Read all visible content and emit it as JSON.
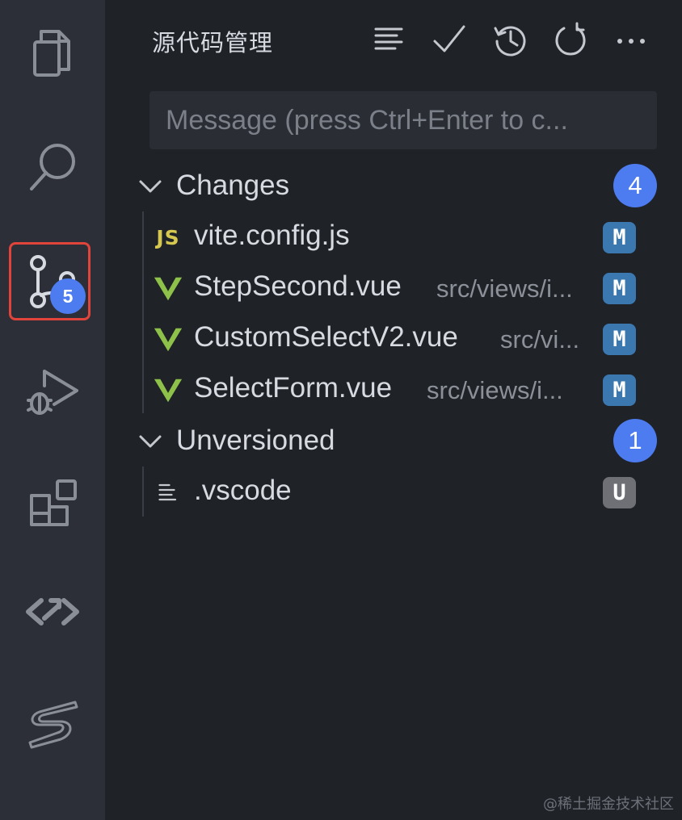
{
  "activity_bar": {
    "items": [
      {
        "name": "explorer",
        "icon": "files-icon"
      },
      {
        "name": "search",
        "icon": "search-icon"
      },
      {
        "name": "source-control",
        "icon": "source-control-icon",
        "badge": "5",
        "active": true
      },
      {
        "name": "run-debug",
        "icon": "run-debug-icon"
      },
      {
        "name": "extensions",
        "icon": "extensions-icon"
      },
      {
        "name": "remote",
        "icon": "remote-explorer-icon"
      },
      {
        "name": "custom",
        "icon": "s-logo-icon"
      }
    ],
    "highlight_color": "#e0443a",
    "badge_color": "#4d7cf0"
  },
  "panel": {
    "title": "源代码管理",
    "actions": [
      "list-tree-icon",
      "check-icon",
      "history-icon",
      "refresh-icon",
      "more-icon"
    ]
  },
  "commit": {
    "placeholder": "Message (press Ctrl+Enter to c..."
  },
  "changes": {
    "label": "Changes",
    "count": "4",
    "files": [
      {
        "name": "vite.config.js",
        "path": "",
        "icon": "JS",
        "status": "M"
      },
      {
        "name": "StepSecond.vue",
        "path": "src/views/i...",
        "icon": "vue-icon",
        "status": "M"
      },
      {
        "name": "CustomSelectV2.vue",
        "path": "src/vi...",
        "icon": "vue-icon",
        "status": "M"
      },
      {
        "name": "SelectForm.vue",
        "path": "src/views/i...",
        "icon": "vue-icon",
        "status": "M"
      }
    ]
  },
  "unversioned": {
    "label": "Unversioned",
    "count": "1",
    "files": [
      {
        "name": ".vscode",
        "icon": "file-lines-icon",
        "status": "U"
      }
    ]
  },
  "watermark": "@稀土掘金技术社区",
  "colors": {
    "accent": "#4d7cf0",
    "modified": "#3c78b0",
    "untracked": "#6e7076",
    "vue": "#8dc149",
    "js": "#d5c74f"
  }
}
